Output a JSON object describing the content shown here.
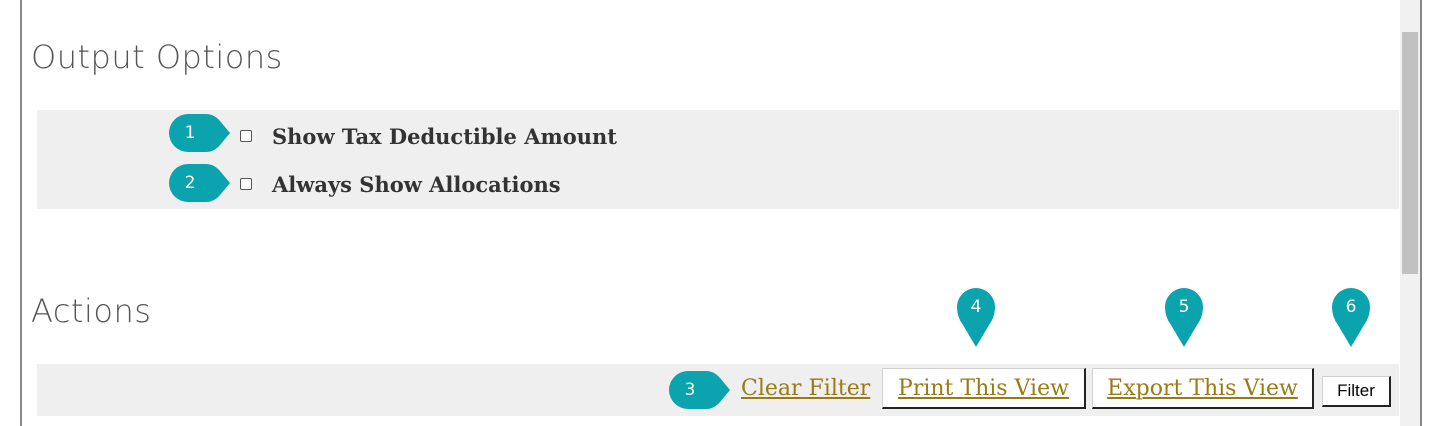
{
  "output_options": {
    "title": "Output Options",
    "options": [
      {
        "label": "Show Tax Deductible Amount",
        "checked": false
      },
      {
        "label": "Always Show Allocations",
        "checked": false
      }
    ]
  },
  "actions": {
    "title": "Actions",
    "clear_filter": "Clear Filter",
    "print_view": "Print This View",
    "export_view": "Export This View",
    "filter": "Filter"
  },
  "markers": [
    "1",
    "2",
    "3",
    "4",
    "5",
    "6"
  ],
  "colors": {
    "marker": "#0aa3ae",
    "link": "#9a7a12",
    "panel": "#efefef"
  }
}
